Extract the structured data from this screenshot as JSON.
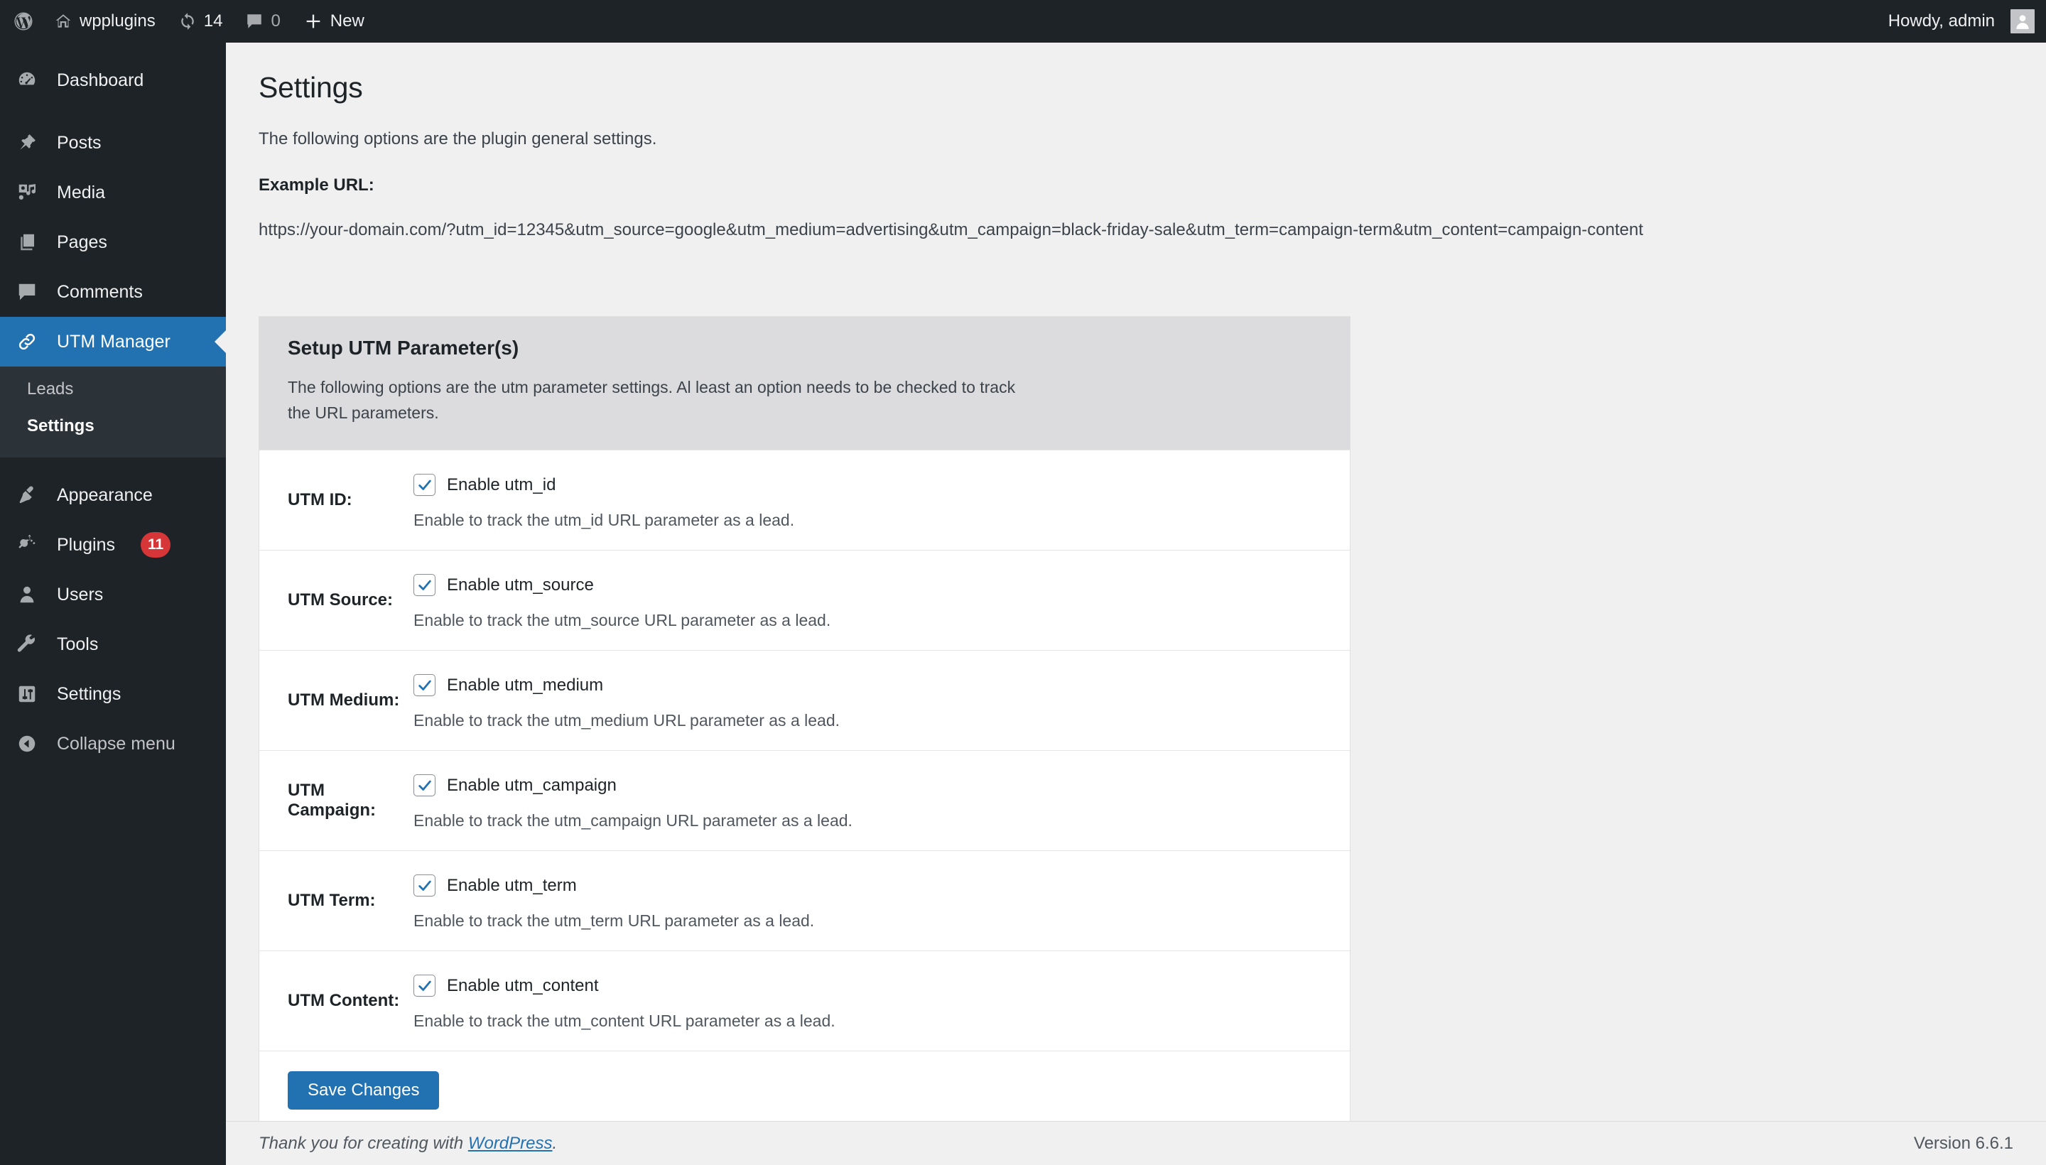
{
  "adminbar": {
    "site_name": "wpplugins",
    "updates_count": "14",
    "comments_count": "0",
    "new_label": "New",
    "howdy": "Howdy, admin",
    "icons": {
      "wordpress": "wordpress-logo-icon",
      "home": "home-icon",
      "updates": "updates-icon",
      "comments": "comment-icon",
      "new": "plus-icon",
      "avatar": "avatar-icon"
    }
  },
  "sidebar": {
    "items": [
      {
        "label": "Dashboard",
        "icon": "dashboard-icon",
        "current": false
      },
      {
        "label": "Posts",
        "icon": "pin-icon",
        "current": false
      },
      {
        "label": "Media",
        "icon": "media-icon",
        "current": false
      },
      {
        "label": "Pages",
        "icon": "pages-icon",
        "current": false
      },
      {
        "label": "Comments",
        "icon": "comment-icon",
        "current": false
      },
      {
        "label": "UTM Manager",
        "icon": "link-icon",
        "current": true
      },
      {
        "label": "Appearance",
        "icon": "paintbrush-icon",
        "current": false
      },
      {
        "label": "Plugins",
        "icon": "plug-icon",
        "current": false,
        "badge": "11"
      },
      {
        "label": "Users",
        "icon": "user-icon",
        "current": false
      },
      {
        "label": "Tools",
        "icon": "wrench-icon",
        "current": false
      },
      {
        "label": "Settings",
        "icon": "sliders-icon",
        "current": false
      }
    ],
    "submenu": [
      {
        "label": "Leads",
        "current": false
      },
      {
        "label": "Settings",
        "current": true
      }
    ],
    "collapse": {
      "label": "Collapse menu",
      "icon": "collapse-arrow-icon"
    }
  },
  "main": {
    "page_title": "Settings",
    "intro": "The following options are the plugin general settings.",
    "example_label": "Example URL:",
    "example_url": "https://your-domain.com/?utm_id=12345&utm_source=google&utm_medium=advertising&utm_campaign=black-friday-sale&utm_term=campaign-term&utm_content=campaign-content",
    "card": {
      "heading": "Setup UTM Parameter(s)",
      "description": "The following options are the utm parameter settings. Al least an option needs to be checked to track the URL parameters.",
      "rows": [
        {
          "label": "UTM ID:",
          "checkbox_label": "Enable utm_id",
          "checked": true,
          "description": "Enable to track the utm_id URL parameter as a lead."
        },
        {
          "label": "UTM Source:",
          "checkbox_label": "Enable utm_source",
          "checked": true,
          "description": "Enable to track the utm_source URL parameter as a lead."
        },
        {
          "label": "UTM Medium:",
          "checkbox_label": "Enable utm_medium",
          "checked": true,
          "description": "Enable to track the utm_medium URL parameter as a lead."
        },
        {
          "label": "UTM Campaign:",
          "checkbox_label": "Enable utm_campaign",
          "checked": true,
          "description": "Enable to track the utm_campaign URL parameter as a lead."
        },
        {
          "label": "UTM Term:",
          "checkbox_label": "Enable utm_term",
          "checked": true,
          "description": "Enable to track the utm_term URL parameter as a lead."
        },
        {
          "label": "UTM Content:",
          "checkbox_label": "Enable utm_content",
          "checked": true,
          "description": "Enable to track the utm_content URL parameter as a lead."
        }
      ],
      "save_label": "Save Changes"
    }
  },
  "footer": {
    "thanks_prefix": "Thank you for creating with ",
    "wordpress_link": "WordPress",
    "thanks_suffix": ".",
    "version": "Version 6.6.1"
  },
  "colors": {
    "admin_dark": "#1d2327",
    "submenu_bg": "#2c3338",
    "accent_blue": "#2271b1",
    "badge_red": "#d63638",
    "page_bg": "#f0f0f1",
    "card_header_bg": "#dcdcde"
  }
}
